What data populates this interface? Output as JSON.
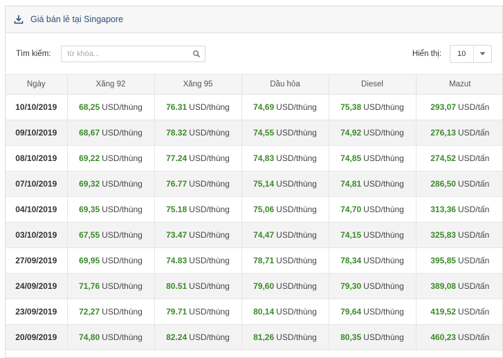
{
  "header": {
    "title": "Giá bán lẻ tại Singapore",
    "icon": "download-icon"
  },
  "search": {
    "label": "Tìm kiếm:",
    "placeholder": "từ khóa..."
  },
  "display": {
    "label": "Hiển thị:",
    "value": "10"
  },
  "table": {
    "columns": [
      "Ngày",
      "Xăng 92",
      "Xăng 95",
      "Dầu hỏa",
      "Diesel",
      "Mazut"
    ],
    "rows": [
      {
        "date": "10/10/2019",
        "cells": [
          {
            "v": "68,25",
            "u": "USD/thùng"
          },
          {
            "v": "76.31",
            "u": "USD/thùng"
          },
          {
            "v": "74,69",
            "u": "USD/thùng"
          },
          {
            "v": "75,38",
            "u": "USD/thùng"
          },
          {
            "v": "293,07",
            "u": "USD/tấn"
          }
        ]
      },
      {
        "date": "09/10/2019",
        "cells": [
          {
            "v": "68,67",
            "u": "USD/thùng"
          },
          {
            "v": "78.32",
            "u": "USD/thùng"
          },
          {
            "v": "74,55",
            "u": "USD/thùng"
          },
          {
            "v": "74,92",
            "u": "USD/thùng"
          },
          {
            "v": "276,13",
            "u": "USD/tấn"
          }
        ]
      },
      {
        "date": "08/10/2019",
        "cells": [
          {
            "v": "69,22",
            "u": "USD/thùng"
          },
          {
            "v": "77.24",
            "u": "USD/thùng"
          },
          {
            "v": "74,83",
            "u": "USD/thùng"
          },
          {
            "v": "74,85",
            "u": "USD/thùng"
          },
          {
            "v": "274,52",
            "u": "USD/tấn"
          }
        ]
      },
      {
        "date": "07/10/2019",
        "cells": [
          {
            "v": "69,32",
            "u": "USD/thùng"
          },
          {
            "v": "76.77",
            "u": "USD/thùng"
          },
          {
            "v": "75,14",
            "u": "USD/thùng"
          },
          {
            "v": "74,81",
            "u": "USD/thùng"
          },
          {
            "v": "286,50",
            "u": "USD/tấn"
          }
        ]
      },
      {
        "date": "04/10/2019",
        "cells": [
          {
            "v": "69,35",
            "u": "USD/thùng"
          },
          {
            "v": "75.18",
            "u": "USD/thùng"
          },
          {
            "v": "75,06",
            "u": "USD/thùng"
          },
          {
            "v": "74,70",
            "u": "USD/thùng"
          },
          {
            "v": "313,36",
            "u": "USD/tấn"
          }
        ]
      },
      {
        "date": "03/10/2019",
        "cells": [
          {
            "v": "67,55",
            "u": "USD/thùng"
          },
          {
            "v": "73.47",
            "u": "USD/thùng"
          },
          {
            "v": "74,47",
            "u": "USD/thùng"
          },
          {
            "v": "74,15",
            "u": "USD/thùng"
          },
          {
            "v": "325,83",
            "u": "USD/tấn"
          }
        ]
      },
      {
        "date": "27/09/2019",
        "cells": [
          {
            "v": "69,95",
            "u": "USD/thùng"
          },
          {
            "v": "74.83",
            "u": "USD/thùng"
          },
          {
            "v": "78,71",
            "u": "USD/thùng"
          },
          {
            "v": "78,34",
            "u": "USD/thùng"
          },
          {
            "v": "395,85",
            "u": "USD/tấn"
          }
        ]
      },
      {
        "date": "24/09/2019",
        "cells": [
          {
            "v": "71,76",
            "u": "USD/thùng"
          },
          {
            "v": "80.51",
            "u": "USD/thùng"
          },
          {
            "v": "79,60",
            "u": "USD/thùng"
          },
          {
            "v": "79,30",
            "u": "USD/thùng"
          },
          {
            "v": "389,08",
            "u": "USD/tấn"
          }
        ]
      },
      {
        "date": "23/09/2019",
        "cells": [
          {
            "v": "72,27",
            "u": "USD/thùng"
          },
          {
            "v": "79.71",
            "u": "USD/thùng"
          },
          {
            "v": "80,14",
            "u": "USD/thùng"
          },
          {
            "v": "79,64",
            "u": "USD/thùng"
          },
          {
            "v": "419,52",
            "u": "USD/tấn"
          }
        ]
      },
      {
        "date": "20/09/2019",
        "cells": [
          {
            "v": "74,80",
            "u": "USD/thùng"
          },
          {
            "v": "82.24",
            "u": "USD/thùng"
          },
          {
            "v": "81,26",
            "u": "USD/thùng"
          },
          {
            "v": "80,35",
            "u": "USD/thùng"
          },
          {
            "v": "460,23",
            "u": "USD/tấn"
          }
        ]
      }
    ]
  },
  "colors": {
    "title": "#2a4f7a",
    "value": "#3b8a2a",
    "header_bg": "#f7f7f7",
    "row_alt": "#f3f3f3"
  }
}
